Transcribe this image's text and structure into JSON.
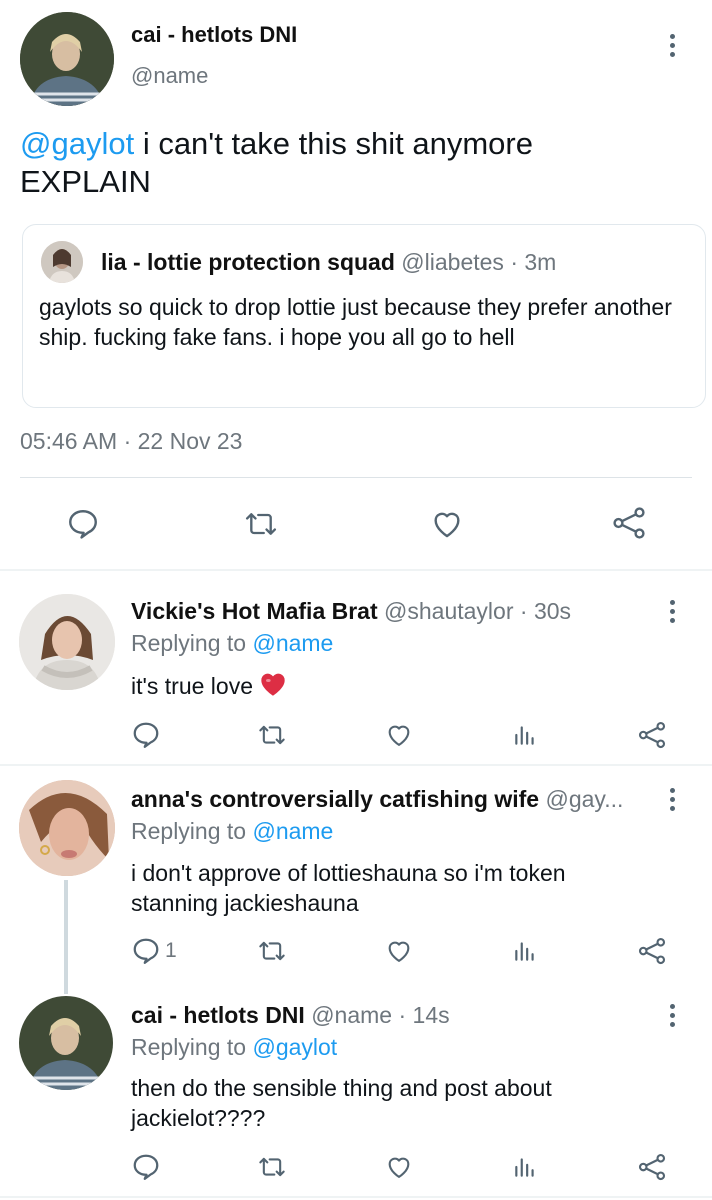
{
  "main": {
    "author_name": "cai - hetlots DNI",
    "author_handle": "@name",
    "text_mention": "@gaylot",
    "text_rest": " i can't take this shit anymore",
    "text_line2": "EXPLAIN",
    "quote": {
      "name": "lia - lottie protection squad",
      "handle": "@liabetes",
      "time": "· 3m",
      "text": "gaylots so quick to drop lottie just because they prefer another ship. fucking fake fans. i hope you all go to hell"
    },
    "timestamp": "05:46 AM · 22 Nov 23",
    "actions": [
      "reply-icon",
      "retweet-icon",
      "like-icon",
      "share-icon"
    ]
  },
  "replies": [
    {
      "name": "Vickie's Hot Mafia Brat",
      "handle": "@shautaylor",
      "time": "· 30s",
      "replying_prefix": "Replying to",
      "replying_to": "@name",
      "text": "it's true love",
      "emoji": "❤️",
      "reply_count": ""
    },
    {
      "name": "anna's controversially catfishing wife",
      "handle": "@gay...",
      "time": "",
      "replying_prefix": "Replying to",
      "replying_to": "@name",
      "text_line1": "i don't approve of lottieshauna so i'm token",
      "text_line2": "stanning jackieshauna",
      "reply_count": "1"
    },
    {
      "name": "cai - hetlots DNI",
      "handle": "@name",
      "time": "· 14s",
      "replying_prefix": "Replying to",
      "replying_to": "@gaylot",
      "text_line1": "then do the sensible thing and post about",
      "text_line2": "jackielot????",
      "reply_count": ""
    }
  ],
  "colors": {
    "accent": "#1d9bf0",
    "text": "#0f1419",
    "muted": "#6e767d",
    "heart": "#e0245e"
  }
}
